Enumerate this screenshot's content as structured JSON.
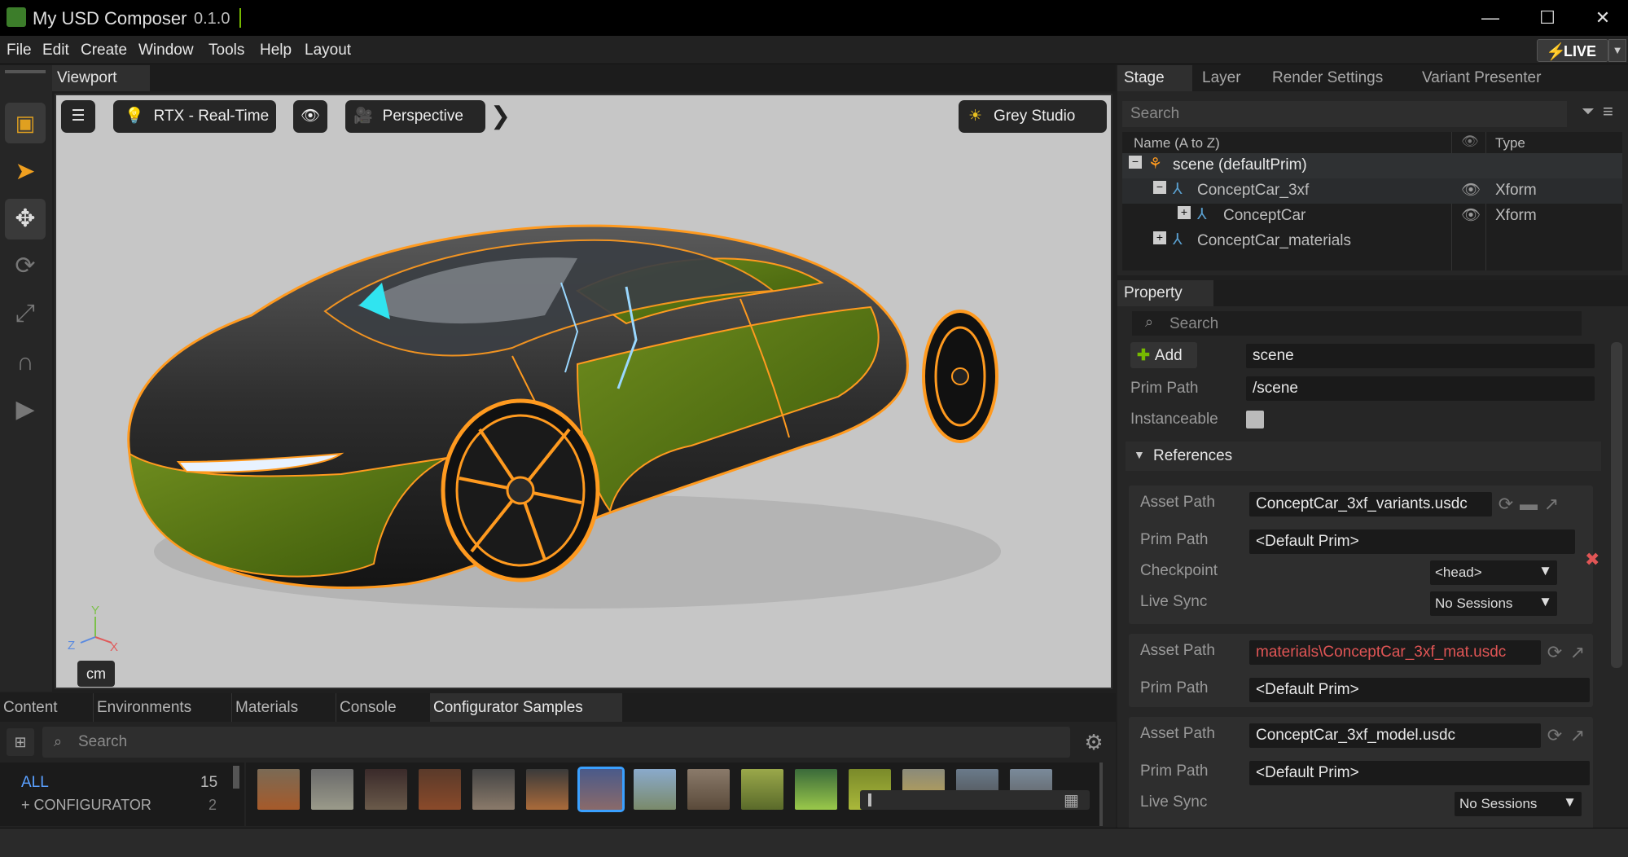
{
  "window": {
    "title": "My USD Composer",
    "version": "0.1.0",
    "minimize": "—",
    "maximize": "☐",
    "close": "✕"
  },
  "menu": [
    "File",
    "Edit",
    "Create",
    "Window",
    "Tools",
    "Help",
    "Layout"
  ],
  "live": {
    "label": "LIVE",
    "color": "#f2c811"
  },
  "viewport": {
    "tab": "Viewport",
    "renderer": "RTX - Real-Time",
    "camera": "Perspective",
    "environment": "Grey Studio",
    "units": "cm",
    "axes": {
      "y": "Y",
      "z": "Z",
      "x": "X"
    }
  },
  "bottom_tabs": [
    "Content",
    "Environments",
    "Materials",
    "Console",
    "Configurator Samples"
  ],
  "content": {
    "search_placeholder": "Search",
    "categories": [
      {
        "name": "ALL",
        "count": "15"
      },
      {
        "name": "+ CONFIGURATOR",
        "count": "2"
      }
    ]
  },
  "stage": {
    "tabs": [
      "Stage",
      "Layer",
      "Render Settings",
      "Variant Presenter"
    ],
    "search_placeholder": "Search",
    "columns": {
      "name": "Name (A to Z)",
      "type": "Type"
    },
    "rows": [
      {
        "label": "scene (defaultPrim)",
        "type": "",
        "expander": "−"
      },
      {
        "label": "ConceptCar_3xf",
        "type": "Xform",
        "expander": "−"
      },
      {
        "label": "ConceptCar",
        "type": "Xform",
        "expander": "+"
      },
      {
        "label": "ConceptCar_materials",
        "type": "",
        "expander": "+"
      }
    ]
  },
  "property": {
    "tab": "Property",
    "search_placeholder": "Search",
    "add_label": "Add",
    "name_value": "scene",
    "prim_path_label": "Prim Path",
    "prim_path_value": "/scene",
    "instanceable_label": "Instanceable",
    "references_label": "References",
    "refs": [
      {
        "asset_label": "Asset Path",
        "asset": "ConceptCar_3xf_variants.usdc",
        "prim_label": "Prim Path",
        "prim": "<Default Prim>",
        "checkpoint_label": "Checkpoint",
        "checkpoint": "<head>",
        "livesync_label": "Live Sync",
        "livesync": "No Sessions"
      },
      {
        "asset_label": "Asset Path",
        "asset": "materials\\ConceptCar_3xf_mat.usdc",
        "prim_label": "Prim Path",
        "prim": "<Default Prim>"
      },
      {
        "asset_label": "Asset Path",
        "asset": "ConceptCar_3xf_model.usdc",
        "prim_label": "Prim Path",
        "prim": "<Default Prim>",
        "livesync_label": "Live Sync",
        "livesync": "No Sessions"
      }
    ]
  },
  "colors": {
    "accent_green": "#76b900",
    "error_red": "#e05555",
    "selection_orange": "#ff9a1f"
  }
}
